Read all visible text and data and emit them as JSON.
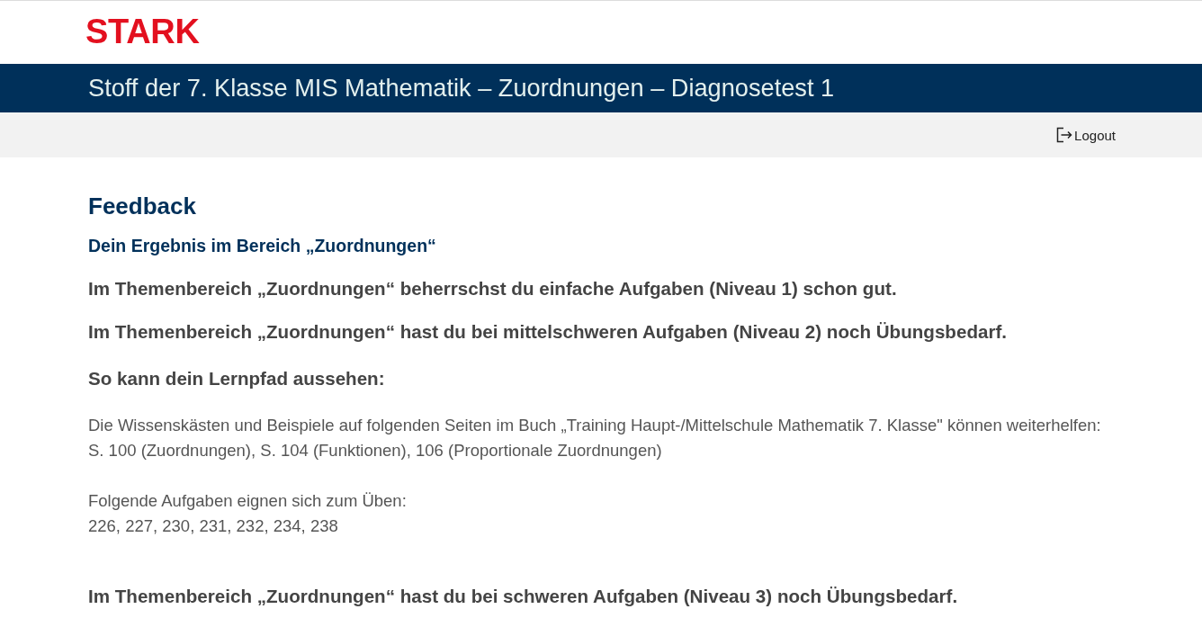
{
  "header": {
    "logo": "STARK"
  },
  "title_bar": {
    "title": "Stoff der 7. Klasse MIS Mathematik – Zuordnungen – Diagnosetest 1"
  },
  "toolbar": {
    "logout": "Logout"
  },
  "feedback": {
    "heading": "Feedback",
    "subheading": "Dein Ergebnis im Bereich „Zuordnungen“",
    "blocks": [
      {
        "kind": "statement",
        "text": "Im Themenbereich „Zuordnungen“ beherrschst du einfache Aufgaben (Niveau 1) schon gut."
      },
      {
        "kind": "statement",
        "text": "Im Themenbereich „Zuordnungen“ hast du bei mittelschweren Aufgaben (Niveau 2) noch Übungsbedarf."
      },
      {
        "kind": "lead",
        "text": "So kann dein Lernpfad aussehen:"
      },
      {
        "kind": "note",
        "lines": [
          "Die Wissenskästen und Beispiele auf folgenden Seiten im Buch „Training Haupt-/Mittelschule Mathematik 7. Klasse\" können weiterhelfen:",
          "S. 100 (Zuordnungen), S. 104 (Funktionen), 106 (Proportionale Zuordnungen)"
        ]
      },
      {
        "kind": "note",
        "lines": [
          "Folgende Aufgaben eignen sich zum Üben:",
          "226, 227, 230, 231, 232, 234, 238"
        ]
      },
      {
        "kind": "statement",
        "text": "Im Themenbereich „Zuordnungen“ hast du bei schweren Aufgaben (Niveau 3) noch Übungsbedarf."
      }
    ]
  }
}
